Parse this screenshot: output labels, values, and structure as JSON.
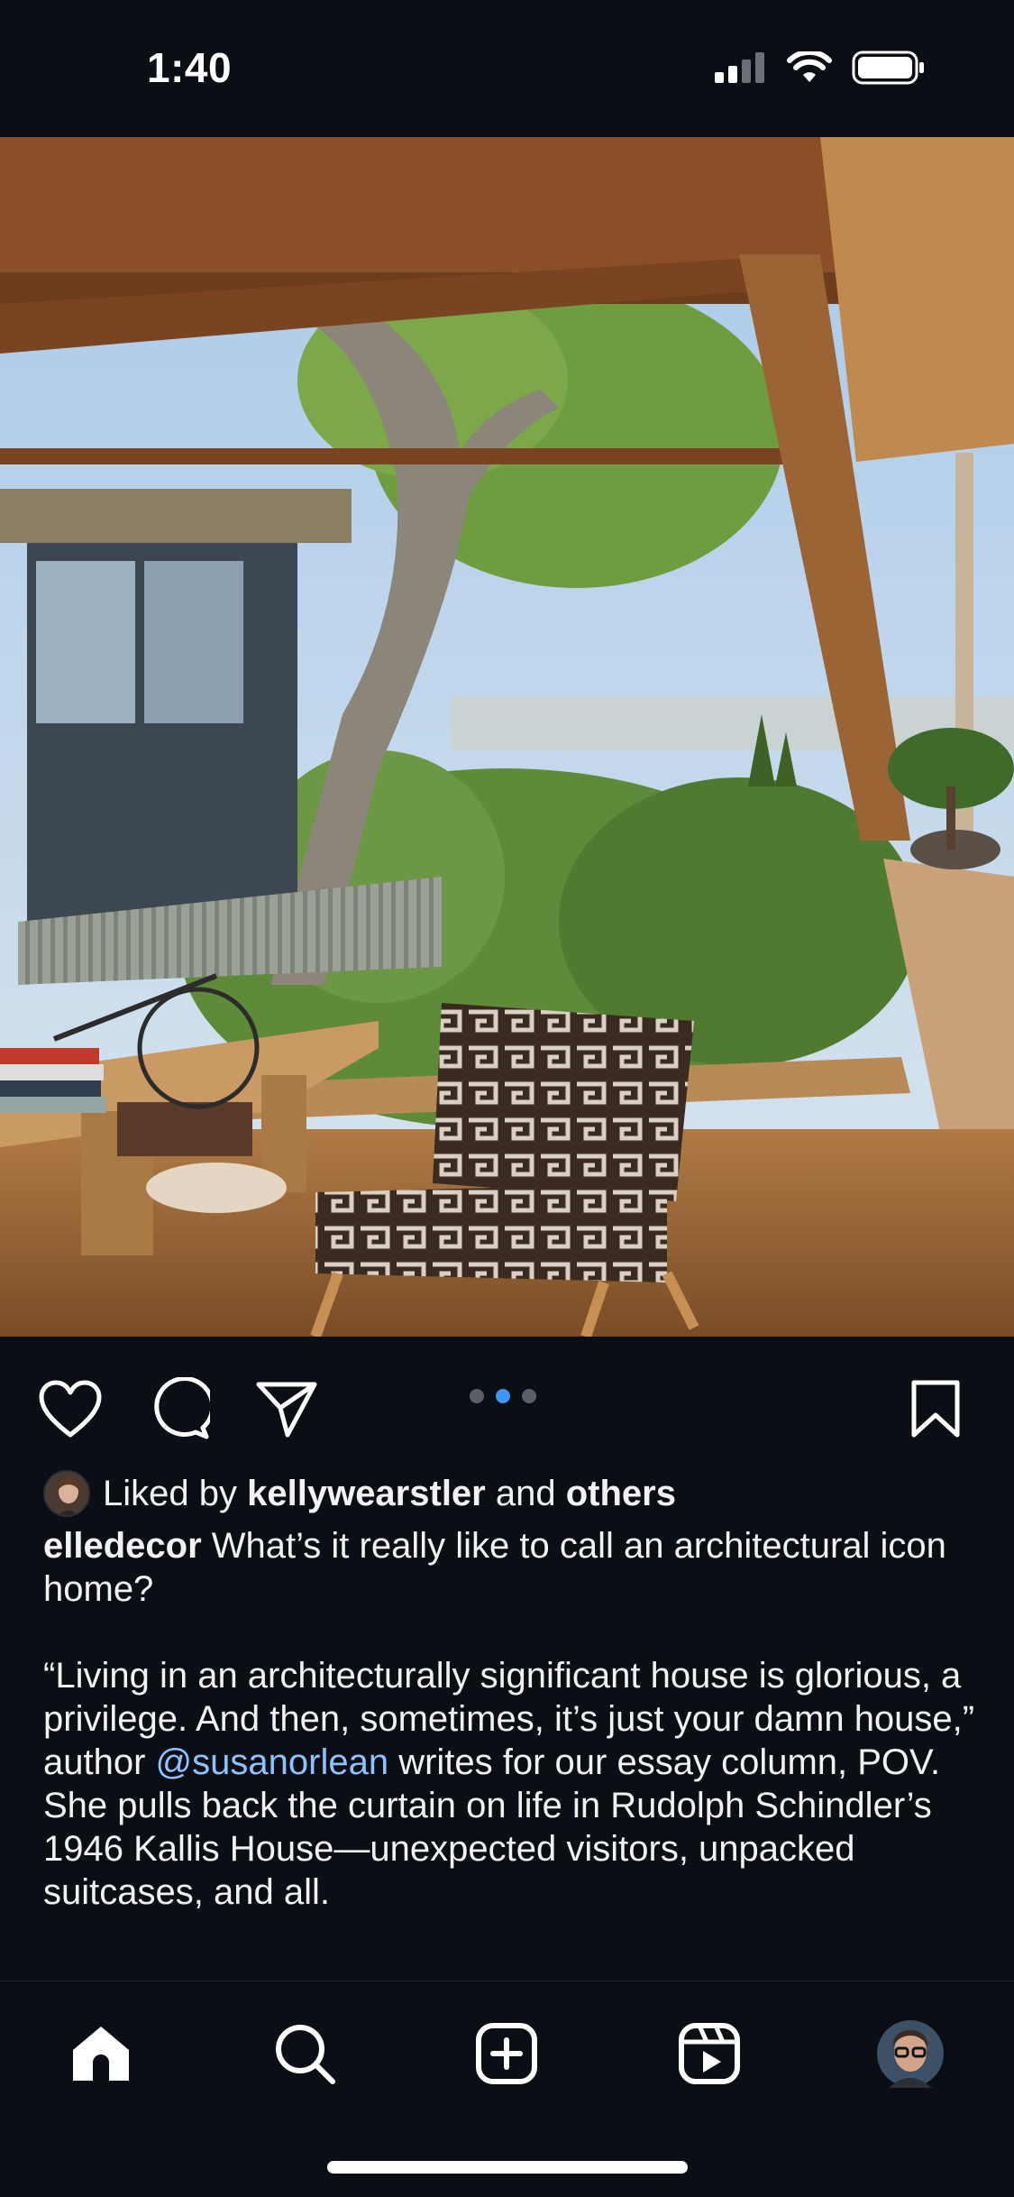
{
  "status_bar": {
    "time": "1:40",
    "icons": [
      "cellular-signal-icon",
      "wifi-icon",
      "battery-icon"
    ]
  },
  "post": {
    "image_description_icon": "photo",
    "carousel": {
      "count": 3,
      "active_index": 1
    },
    "actions": {
      "like_icon": "heart-icon",
      "comment_icon": "comment-bubble-icon",
      "share_icon": "paper-plane-icon",
      "save_icon": "bookmark-icon"
    },
    "likes": {
      "prefix": "Liked by ",
      "user": "kellywearstler",
      "middle": " and ",
      "suffix": "others"
    },
    "caption": {
      "username": "elledecor",
      "headline": " What’s it really like to call an architectural icon home?",
      "body_part1": "“Living in an architecturally significant house is glorious, a privilege. And then, sometimes, it’s just your damn house,” author ",
      "mention": "@susanorlean",
      "body_part2": " writes for our essay column, POV. She pulls back the curtain on life in Rudolph Schindler’s 1946 Kallis House—unexpected visitors, unpacked suitcases, and all."
    }
  },
  "tab_bar": {
    "items": [
      "home-icon",
      "search-icon",
      "create-post-icon",
      "reels-icon",
      "profile-avatar"
    ],
    "active": "home-icon"
  },
  "colors": {
    "background": "#0b0e14",
    "mention": "#8ec2ff",
    "carousel_active": "#3f95f5"
  }
}
